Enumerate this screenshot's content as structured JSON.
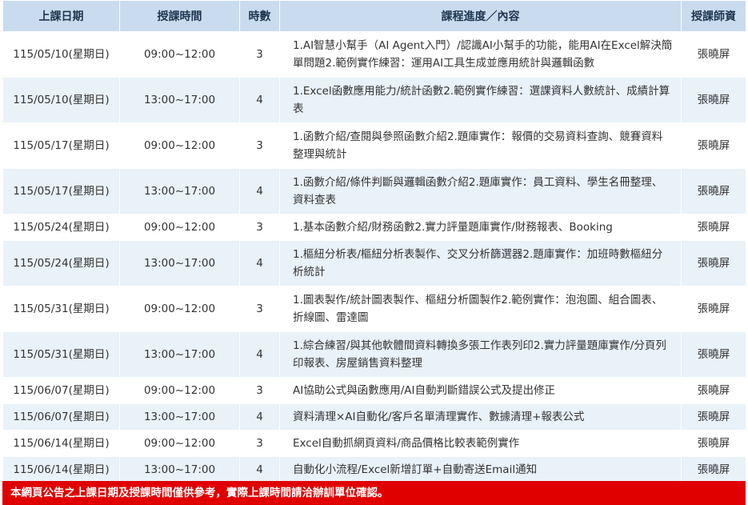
{
  "headers": [
    "上課日期",
    "授課時間",
    "時數",
    "課程進度／內容",
    "授課師資"
  ],
  "rows": [
    {
      "date": "115/05/10(星期日)",
      "time": "09:00~12:00",
      "hours": "3",
      "content": "1.AI智慧小幫手（AI Agent入門）/認識AI小幫手的功能，能用AI在Excel解決簡單問題2.範例實作練習：運用AI工具生成並應用統計與邏輯函數",
      "teacher": "張曉屏"
    },
    {
      "date": "115/05/10(星期日)",
      "time": "13:00~17:00",
      "hours": "4",
      "content": "1.Excel函數應用能力/統計函數2.範例實作練習：選課資料人數統計、成績計算表",
      "teacher": "張曉屏"
    },
    {
      "date": "115/05/17(星期日)",
      "time": "09:00~12:00",
      "hours": "3",
      "content": "1.函數介紹/查閱與參照函數介紹2.題庫實作：報價的交易資料查詢、競賽資料整理與統計",
      "teacher": "張曉屏"
    },
    {
      "date": "115/05/17(星期日)",
      "time": "13:00~17:00",
      "hours": "4",
      "content": "1.函數介紹/條件判斷與邏輯函數介紹2.題庫實作：員工資料、學生名冊整理、資料查表",
      "teacher": "張曉屏"
    },
    {
      "date": "115/05/24(星期日)",
      "time": "09:00~12:00",
      "hours": "3",
      "content": "1.基本函數介紹/財務函數2.實力評量題庫實作/財務報表、Booking",
      "teacher": "張曉屏"
    },
    {
      "date": "115/05/24(星期日)",
      "time": "13:00~17:00",
      "hours": "4",
      "content": "1.樞紐分析表/樞紐分析表製作、交叉分析篩選器2.題庫實作：加班時數樞紐分析統計",
      "teacher": "張曉屏"
    },
    {
      "date": "115/05/31(星期日)",
      "time": "09:00~12:00",
      "hours": "3",
      "content": "1.圖表製作/統計圖表製作、樞紐分析圖製作2.範例實作：泡泡圖、組合圖表、折線圖、雷達圖",
      "teacher": "張曉屏"
    },
    {
      "date": "115/05/31(星期日)",
      "time": "13:00~17:00",
      "hours": "4",
      "content": "1.綜合練習/與其他軟體間資料轉換多張工作表列印2.實力評量題庫實作/分頁列印報表、房屋銷售資料整理",
      "teacher": "張曉屏"
    },
    {
      "date": "115/06/07(星期日)",
      "time": "09:00~12:00",
      "hours": "3",
      "content": "AI協助公式與函數應用/AI自動判斷錯誤公式及提出修正",
      "teacher": "張曉屏"
    },
    {
      "date": "115/06/07(星期日)",
      "time": "13:00~17:00",
      "hours": "4",
      "content": "資料清理×AI自動化/客戶名單清理實作、數據清理+報表公式",
      "teacher": "張曉屏"
    },
    {
      "date": "115/06/14(星期日)",
      "time": "09:00~12:00",
      "hours": "3",
      "content": "Excel自動抓網頁資料/商品價格比較表範例實作",
      "teacher": "張曉屏"
    },
    {
      "date": "115/06/14(星期日)",
      "time": "13:00~17:00",
      "hours": "4",
      "content": "自動化小流程/Excel新增訂單+自動寄送Email通知",
      "teacher": "張曉屏"
    }
  ],
  "notice": "本網頁公告之上課日期及授課時間僅供參考，實際上課時間請洽辦訓單位確認。",
  "colors": {
    "header_bg": "#c9dcef",
    "stripe_bg": "#e9f1f9",
    "notice_bg": "#e00000"
  }
}
